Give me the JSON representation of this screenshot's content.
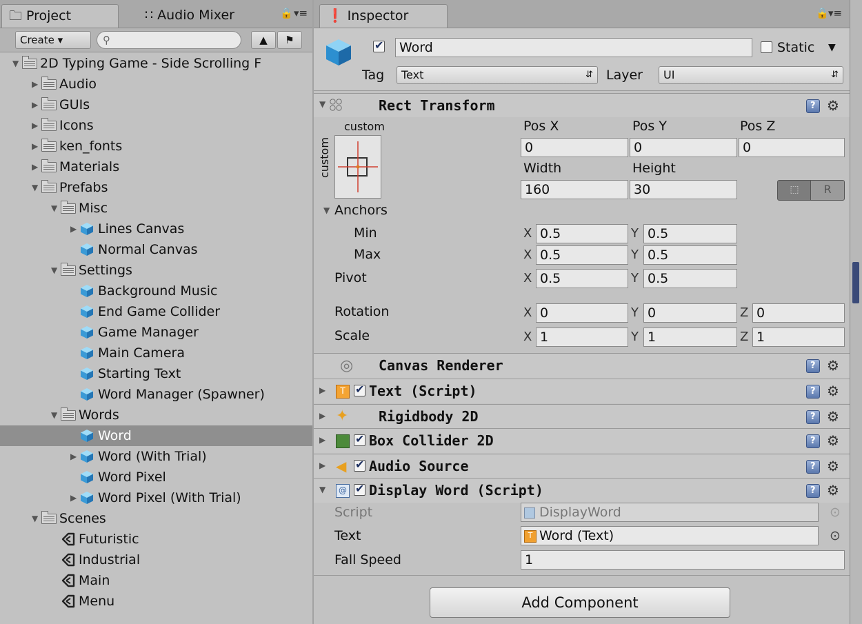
{
  "project": {
    "tabs": [
      "Project",
      "Audio Mixer"
    ],
    "create_label": "Create",
    "tree": [
      {
        "label": "2D Typing Game - Side Scrolling F",
        "icon": "folder-icon",
        "expanded": true
      },
      {
        "label": "Audio",
        "icon": "folder-icon",
        "expanded": false
      },
      {
        "label": "GUIs",
        "icon": "folder-icon",
        "expanded": false
      },
      {
        "label": "Icons",
        "icon": "folder-icon",
        "expanded": false
      },
      {
        "label": "ken_fonts",
        "icon": "folder-icon",
        "expanded": false
      },
      {
        "label": "Materials",
        "icon": "folder-icon",
        "expanded": false
      },
      {
        "label": "Prefabs",
        "icon": "folder-icon",
        "expanded": true
      },
      {
        "label": "Misc",
        "icon": "folder-icon",
        "expanded": true
      },
      {
        "label": "Lines Canvas",
        "icon": "prefab-icon",
        "expanded": false
      },
      {
        "label": "Normal Canvas",
        "icon": "prefab-icon"
      },
      {
        "label": "Settings",
        "icon": "folder-icon",
        "expanded": true
      },
      {
        "label": "Background Music",
        "icon": "prefab-icon"
      },
      {
        "label": "End Game Collider",
        "icon": "prefab-icon"
      },
      {
        "label": "Game Manager",
        "icon": "prefab-icon"
      },
      {
        "label": "Main Camera",
        "icon": "prefab-icon"
      },
      {
        "label": "Starting Text",
        "icon": "prefab-icon"
      },
      {
        "label": "Word Manager (Spawner)",
        "icon": "prefab-icon"
      },
      {
        "label": "Words",
        "icon": "folder-icon",
        "expanded": true
      },
      {
        "label": "Word",
        "icon": "prefab-icon",
        "selected": true
      },
      {
        "label": "Word (With Trial)",
        "icon": "prefab-icon",
        "expanded": false
      },
      {
        "label": "Word Pixel",
        "icon": "prefab-icon"
      },
      {
        "label": "Word Pixel (With Trial)",
        "icon": "prefab-icon",
        "expanded": false
      },
      {
        "label": "Scenes",
        "icon": "folder-icon",
        "expanded": true
      },
      {
        "label": "Futuristic",
        "icon": "scene-icon"
      },
      {
        "label": "Industrial",
        "icon": "scene-icon"
      },
      {
        "label": "Main",
        "icon": "scene-icon"
      },
      {
        "label": "Menu",
        "icon": "scene-icon"
      }
    ]
  },
  "inspector": {
    "tab": "Inspector",
    "object": {
      "name": "Word",
      "active": true,
      "static_label": "Static",
      "static": false,
      "tag_label": "Tag",
      "tag": "Text",
      "layer_label": "Layer",
      "layer": "UI"
    },
    "rect_transform": {
      "title": "Rect Transform",
      "anchor_preset": "custom",
      "anchor_preset_side": "custom",
      "pos_x_label": "Pos X",
      "pos_y_label": "Pos Y",
      "pos_z_label": "Pos Z",
      "pos_x": "0",
      "pos_y": "0",
      "pos_z": "0",
      "width_label": "Width",
      "height_label": "Height",
      "width": "160",
      "height": "30",
      "r_label": "R",
      "anchors_label": "Anchors",
      "min_label": "Min",
      "max_label": "Max",
      "pivot_label": "Pivot",
      "min_x": "0.5",
      "min_y": "0.5",
      "max_x": "0.5",
      "max_y": "0.5",
      "pivot_x": "0.5",
      "pivot_y": "0.5",
      "rotation_label": "Rotation",
      "rot_x": "0",
      "rot_y": "0",
      "rot_z": "0",
      "scale_label": "Scale",
      "scale_x": "1",
      "scale_y": "1",
      "scale_z": "1",
      "x": "X",
      "y": "Y",
      "z": "Z"
    },
    "components": [
      {
        "title": "Canvas Renderer",
        "icon": "canvas-renderer-icon",
        "checkbox": false
      },
      {
        "title": "Text (Script)",
        "icon": "text-icon",
        "checkbox": true
      },
      {
        "title": "Rigidbody 2D",
        "icon": "rigidbody-icon",
        "checkbox": false
      },
      {
        "title": "Box Collider 2D",
        "icon": "box-collider-icon",
        "checkbox": true
      },
      {
        "title": "Audio Source",
        "icon": "audio-source-icon",
        "checkbox": true
      },
      {
        "title": "Display Word (Script)",
        "icon": "script-icon",
        "checkbox": true
      }
    ],
    "display_word": {
      "script_label": "Script",
      "script_value": "DisplayWord",
      "text_label": "Text",
      "text_value": "Word (Text)",
      "fall_speed_label": "Fall Speed",
      "fall_speed": "1"
    },
    "add_component_label": "Add Component"
  }
}
